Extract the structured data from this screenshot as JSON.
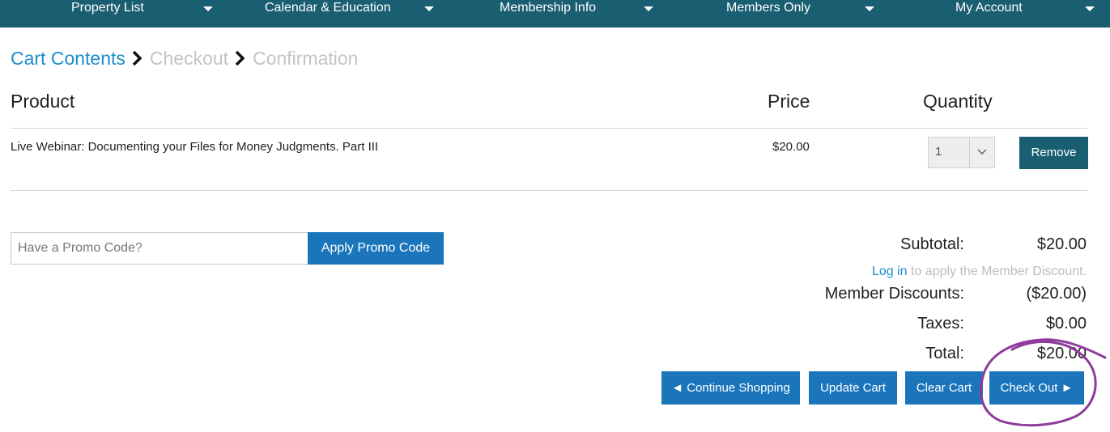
{
  "nav": {
    "items": [
      {
        "label": "Property List"
      },
      {
        "label": "Calendar & Education"
      },
      {
        "label": "Membership Info"
      },
      {
        "label": "Members Only"
      },
      {
        "label": "My Account"
      }
    ],
    "background": "#1a5e72"
  },
  "breadcrumb": {
    "steps": [
      "Cart Contents",
      "Checkout",
      "Confirmation"
    ],
    "active_index": 0,
    "active_color": "#1a8fc9",
    "inactive_color": "#c4c4c4"
  },
  "cart": {
    "headers": {
      "product": "Product",
      "price": "Price",
      "quantity": "Quantity"
    },
    "rows": [
      {
        "product": "Live Webinar: Documenting your Files for Money Judgments. Part III",
        "price": "$20.00",
        "quantity": "1",
        "remove_label": "Remove"
      }
    ]
  },
  "promo": {
    "placeholder": "Have a Promo Code?",
    "value": "",
    "apply_label": "Apply Promo Code"
  },
  "summary": {
    "subtotal_label": "Subtotal:",
    "subtotal_value": "$20.00",
    "login_link": "Log in",
    "login_suffix": " to apply the Member Discount.",
    "member_discounts_label": "Member Discounts:",
    "member_discounts_value": "($20.00)",
    "taxes_label": "Taxes:",
    "taxes_value": "$0.00",
    "total_label": "Total:",
    "total_value": "$20.00"
  },
  "actions": {
    "continue_shopping": "◄ Continue Shopping",
    "update_cart": "Update Cart",
    "clear_cart": "Clear Cart",
    "check_out": "Check Out ►"
  },
  "colors": {
    "primary_button": "#1a75bb",
    "dark_button": "#1a5e72",
    "annotation": "#8e3b9b"
  }
}
